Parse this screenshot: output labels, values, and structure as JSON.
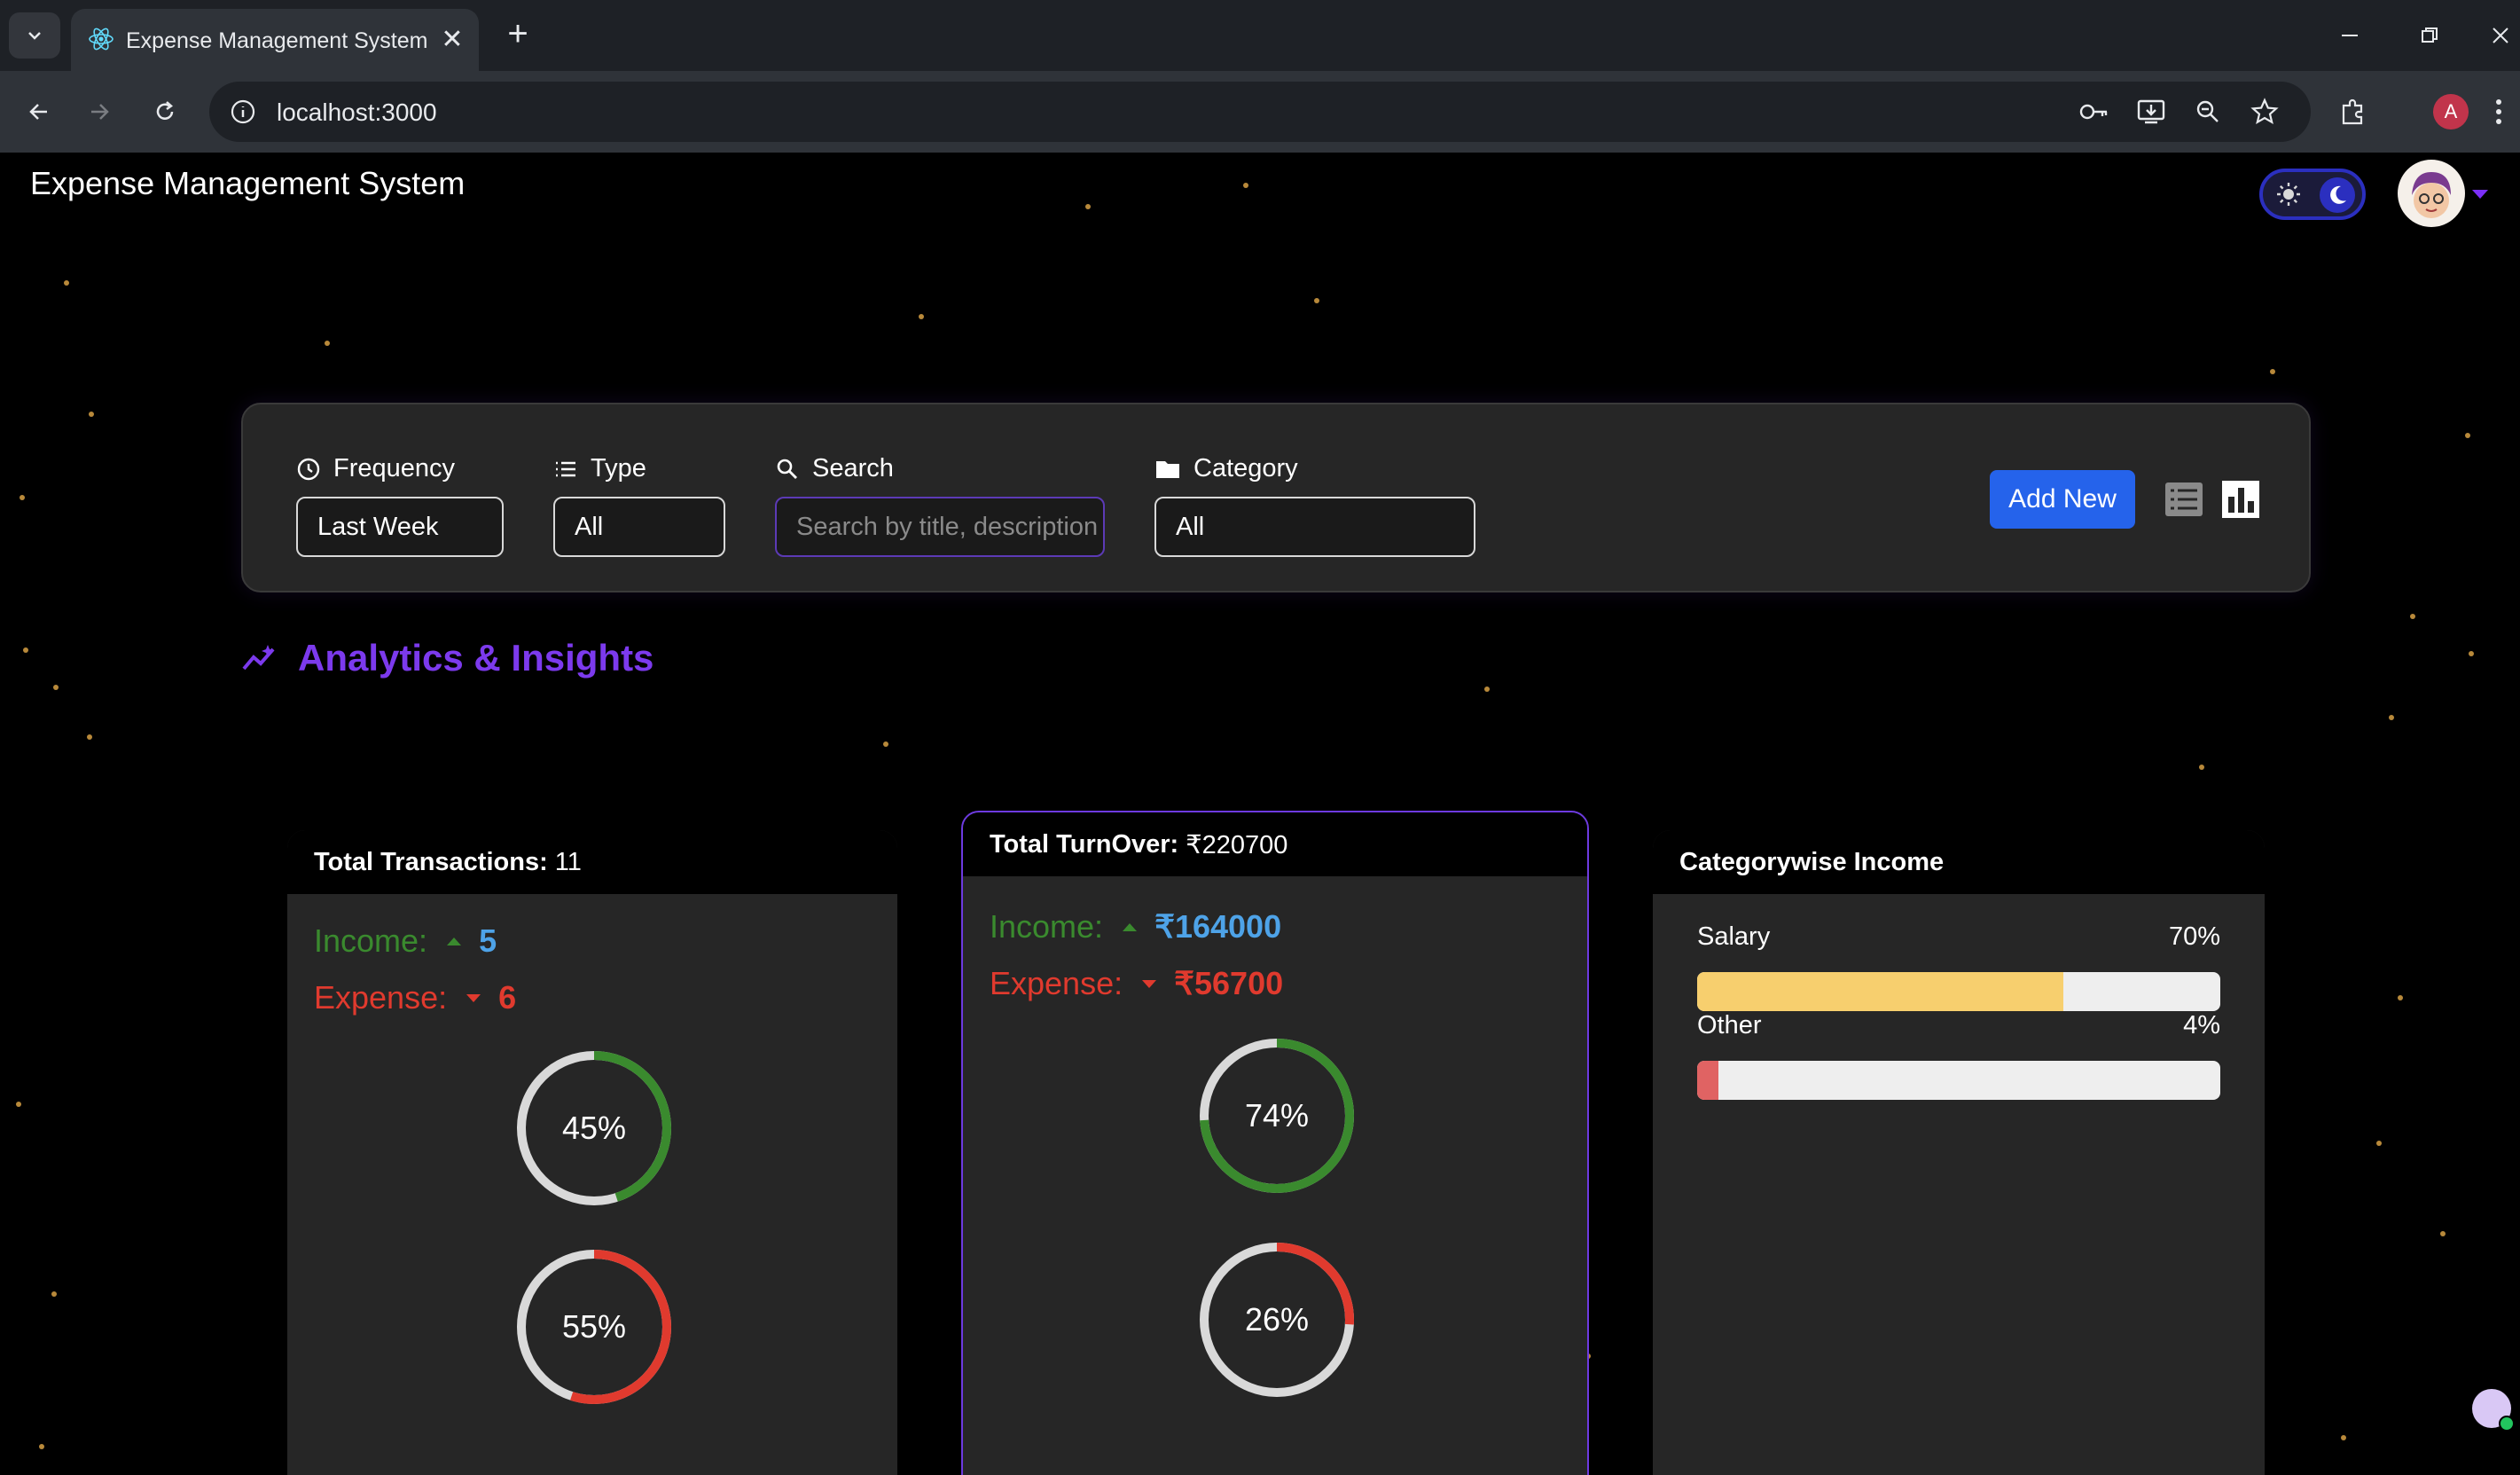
{
  "browser": {
    "tab_title": "Expense Management System",
    "url": "localhost:3000",
    "profile_initial": "A"
  },
  "header": {
    "app_title": "Expense Management System"
  },
  "filters": {
    "frequency": {
      "label": "Frequency",
      "value": "Last Week"
    },
    "type": {
      "label": "Type",
      "value": "All"
    },
    "search": {
      "label": "Search",
      "placeholder": "Search by title, description"
    },
    "category": {
      "label": "Category",
      "value": "All"
    },
    "add_new_label": "Add New"
  },
  "analytics": {
    "title": "Analytics & Insights"
  },
  "transactions_card": {
    "title": "Total Transactions:",
    "total": "11",
    "income_label": "Income:",
    "income_value": "5",
    "expense_label": "Expense:",
    "expense_value": "6",
    "income_pct": 45,
    "income_pct_label": "45%",
    "expense_pct": 55,
    "expense_pct_label": "55%"
  },
  "turnover_card": {
    "title": "Total TurnOver:",
    "total": "₹220700",
    "income_label": "Income:",
    "income_value": "₹164000",
    "expense_label": "Expense:",
    "expense_value": "₹56700",
    "income_pct": 74,
    "income_pct_label": "74%",
    "expense_pct": 26,
    "expense_pct_label": "26%"
  },
  "category_card": {
    "title": "Categorywise Income",
    "items": [
      {
        "name": "Salary",
        "pct_label": "70%",
        "pct": 70,
        "color": "#f7cf6e"
      },
      {
        "name": "Other",
        "pct_label": "4%",
        "pct": 4,
        "color": "#e06363"
      }
    ]
  },
  "colors": {
    "income": "#3a8a2e",
    "expense": "#e03a2e",
    "accent": "#7c3aed",
    "primary_button": "#2563eb"
  }
}
